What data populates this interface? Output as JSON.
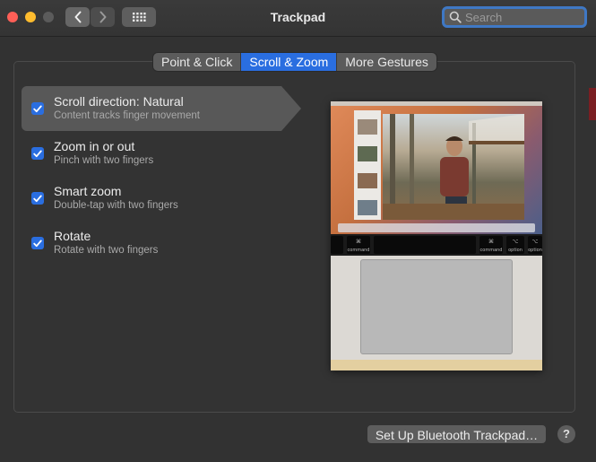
{
  "window": {
    "title": "Trackpad"
  },
  "toolbar": {
    "back_icon": "chevron-left-icon",
    "forward_icon": "chevron-right-icon",
    "grid_icon": "grid-icon",
    "search_placeholder": "Search"
  },
  "tabs": [
    {
      "label": "Point & Click",
      "active": false
    },
    {
      "label": "Scroll & Zoom",
      "active": true
    },
    {
      "label": "More Gestures",
      "active": false
    }
  ],
  "options": [
    {
      "title": "Scroll direction: Natural",
      "subtitle": "Content tracks finger movement",
      "checked": true,
      "selected": true
    },
    {
      "title": "Zoom in or out",
      "subtitle": "Pinch with two fingers",
      "checked": true,
      "selected": false
    },
    {
      "title": "Smart zoom",
      "subtitle": "Double-tap with two fingers",
      "checked": true,
      "selected": false
    },
    {
      "title": "Rotate",
      "subtitle": "Rotate with two fingers",
      "checked": true,
      "selected": false
    }
  ],
  "preview": {
    "keys": [
      {
        "symbol": "⌥",
        "label": "option"
      },
      {
        "symbol": "⌘",
        "label": "command"
      },
      {
        "symbol": "⌘",
        "label": "command"
      },
      {
        "symbol": "⌥",
        "label": "option"
      }
    ]
  },
  "footer": {
    "bluetooth_button": "Set Up Bluetooth Trackpad…",
    "help_label": "?"
  },
  "colors": {
    "accent": "#2a6ee0",
    "close": "#ff5f57",
    "minimize": "#febc2e",
    "maximize_disabled": "#5b5b5b"
  }
}
